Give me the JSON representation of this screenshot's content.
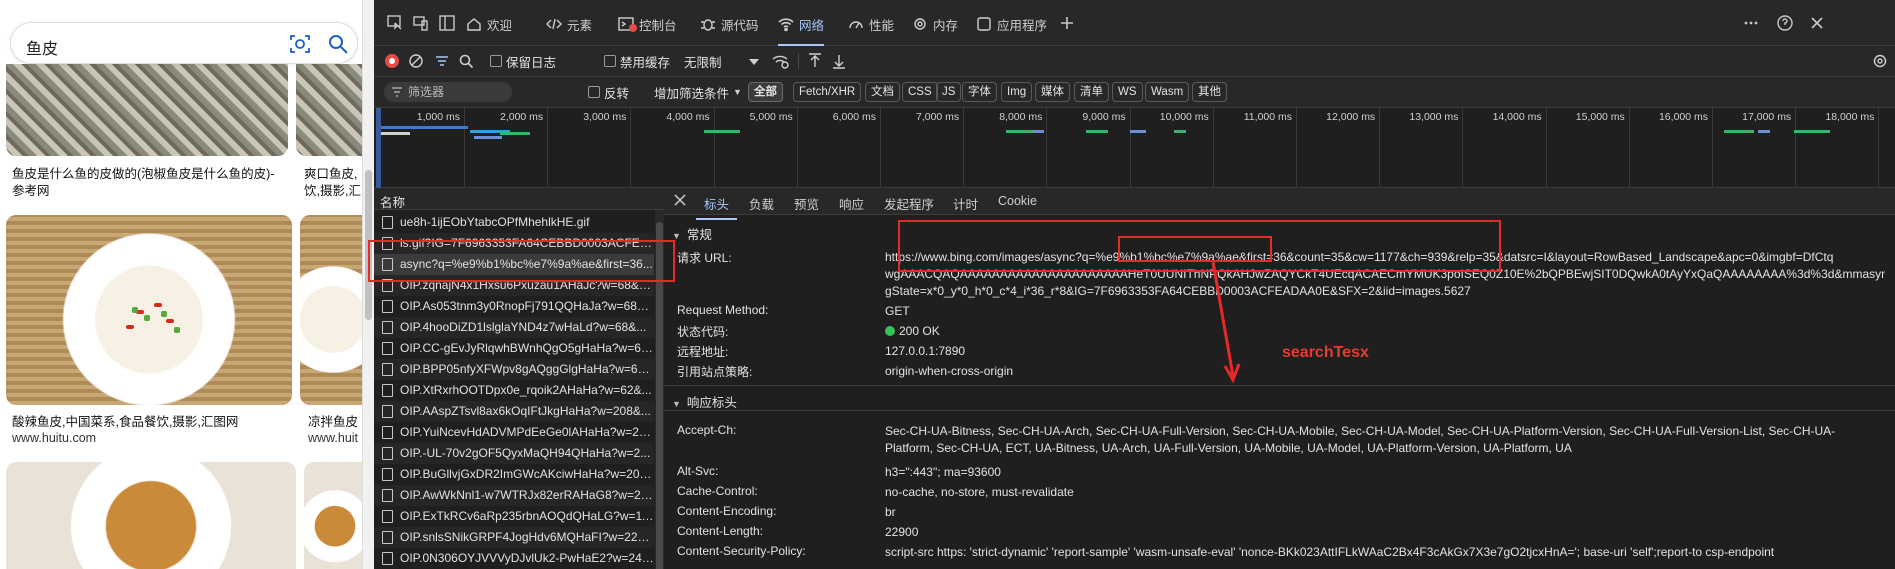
{
  "browser": {
    "search_query": "鱼皮",
    "results": [
      {
        "caption": "鱼皮是什么鱼的皮做的(泡椒鱼皮是什么鱼的皮)-参考网",
        "source": ""
      },
      {
        "caption": "爽口鱼皮,",
        "caption2": "饮,摄影,汇",
        "source": ""
      },
      {
        "caption": "酸辣鱼皮,中国菜系,食品餐饮,摄影,汇图网",
        "source": "www.huitu.com"
      },
      {
        "caption": "凉拌鱼皮",
        "source": "www.huit"
      }
    ]
  },
  "devtools": {
    "tabs": [
      {
        "label": "欢迎",
        "icon": "home-icon"
      },
      {
        "label": "元素",
        "icon": "code-icon"
      },
      {
        "label": "控制台",
        "icon": "console-icon"
      },
      {
        "label": "源代码",
        "icon": "bug-icon"
      },
      {
        "label": "网络",
        "icon": "wifi-icon"
      },
      {
        "label": "性能",
        "icon": "gauge-icon"
      },
      {
        "label": "内存",
        "icon": "gear-icon"
      },
      {
        "label": "应用程序",
        "icon": "app-icon"
      }
    ],
    "toolbar": {
      "preserve_log": "保留日志",
      "disable_cache": "禁用缓存",
      "throttle": "无限制"
    },
    "filter": {
      "placeholder": "筛选器",
      "invert": "反转",
      "more_filters": "增加筛选条件",
      "chips": [
        "全部",
        "Fetch/XHR",
        "文档",
        "CSS",
        "JS",
        "字体",
        "Img",
        "媒体",
        "清单",
        "WS",
        "Wasm",
        "其他"
      ]
    },
    "timeline_ticks": [
      "1,000 ms",
      "2,000 ms",
      "3,000 ms",
      "4,000 ms",
      "5,000 ms",
      "6,000 ms",
      "7,000 ms",
      "8,000 ms",
      "9,000 ms",
      "10,000 ms",
      "11,000 ms",
      "12,000 ms",
      "13,000 ms",
      "14,000 ms",
      "15,000 ms",
      "16,000 ms",
      "17,000 ms",
      "18,000 ms"
    ],
    "list_header": "名称",
    "requests": [
      "ue8h-1ijEObYtabcOPfMhehlkHE.gif",
      "ls.gif?IG=7F6963353FA64CEBBD0003ACFEAD...",
      "async?q=%e9%b1%bc%e7%9a%ae&first=36...",
      "OIP.zqnajN4x1Hxsu6Pxuzau1AHaJc?w=68&h...",
      "OIP.As053tnm3y0RnopFj791QQHaJa?w=68&...",
      "OIP.4hooDiZD1lslglaYND4z7wHaLd?w=68&...",
      "OIP.CC-gEvJyRlqwhBWnhQgO5gHaHa?w=62...",
      "OIP.BPP05nfyXFWpv8gAQggGlgHaHa?w=62...",
      "OIP.XtRxrhOOTDpx0e_rqoik2AHaHa?w=62&...",
      "OIP.AAspZTsvl8ax6kOqIFtJkgHaHa?w=208&...",
      "OIP.YuiNcevHdADVMPdEeGe0lAHaHa?w=20...",
      "OIP.-UL-70v2gOF5QyxMaQH94QHaHa?w=2...",
      "OIP.BuGllvjGxDR2ImGWcAKciwHaHa?w=209...",
      "OIP.AwWkNnl1-w7WTRJx82erRAHaG8?w=22...",
      "OIP.ExTkRCv6aRp235rbnAOQdQHaLG?w=11...",
      "OIP.snlsSNikGRPF4JogHdv6MQHaFI?w=229...",
      "OIP.0N306OYJVVVyDJvlUk2-PwHaE2?w=241..."
    ],
    "selected_request_index": 2,
    "detail_tabs": [
      "标头",
      "负载",
      "预览",
      "响应",
      "发起程序",
      "计时",
      "Cookie"
    ],
    "general": {
      "title": "常规",
      "request_url_label": "请求 URL:",
      "request_url_line1": "https://www.bing.com/images/async?q=%e9%b1%bc%e7%9a%ae&first=36&count=35&cw=1177&ch=939&relp=35&datsrc=I&layout=RowBased_Landscape&apc=0&imgbf=DfCtq",
      "request_url_line2": "wgAAACQAQAAAAAAAAAAAAAAAAAAAAAHeT0UUNIThNPQkAHJwZAQYCkT4UEcqACAECmYMUK3poISEQ0Z10E%2bQPBEwjSIT0DQwkA0tAyYxQaQAAAAAAAA%3d%3d&mmasync=1&d",
      "request_url_line3": "gState=x*0_y*0_h*0_c*4_i*36_r*8&IG=7F6963353FA64CEBBD0003ACFEADAA0E&SFX=2&iid=images.5627",
      "method_label": "Request Method:",
      "method": "GET",
      "status_label": "状态代码:",
      "status": "200 OK",
      "remote_label": "远程地址:",
      "remote": "127.0.0.1:7890",
      "referrer_label": "引用站点策略:",
      "referrer": "origin-when-cross-origin"
    },
    "response_headers": {
      "title": "响应标头",
      "rows": [
        {
          "key": "Accept-Ch:",
          "value": "Sec-CH-UA-Bitness, Sec-CH-UA-Arch, Sec-CH-UA-Full-Version, Sec-CH-UA-Mobile, Sec-CH-UA-Model, Sec-CH-UA-Platform-Version, Sec-CH-UA-Full-Version-List, Sec-CH-UA-",
          "value2": "Platform, Sec-CH-UA, ECT, UA-Bitness, UA-Arch, UA-Full-Version, UA-Mobile, UA-Model, UA-Platform-Version, UA-Platform, UA"
        },
        {
          "key": "Alt-Svc:",
          "value": "h3=\":443\"; ma=93600"
        },
        {
          "key": "Cache-Control:",
          "value": "no-cache, no-store, must-revalidate"
        },
        {
          "key": "Content-Encoding:",
          "value": "br"
        },
        {
          "key": "Content-Length:",
          "value": "22900"
        },
        {
          "key": "Content-Security-Policy:",
          "value": "script-src https: 'strict-dynamic' 'report-sample' 'wasm-unsafe-eval' 'nonce-BKk023AttIFLkWAaC2Bx4F3cAkGx7X3e7gO2tjcxHnA='; base-uri 'self';report-to csp-endpoint"
        }
      ]
    },
    "annotation_text": "searchTesx"
  },
  "colors": {
    "accent": "#a8c7fa",
    "annotation": "#ea2828",
    "status_ok": "#34c35a"
  }
}
